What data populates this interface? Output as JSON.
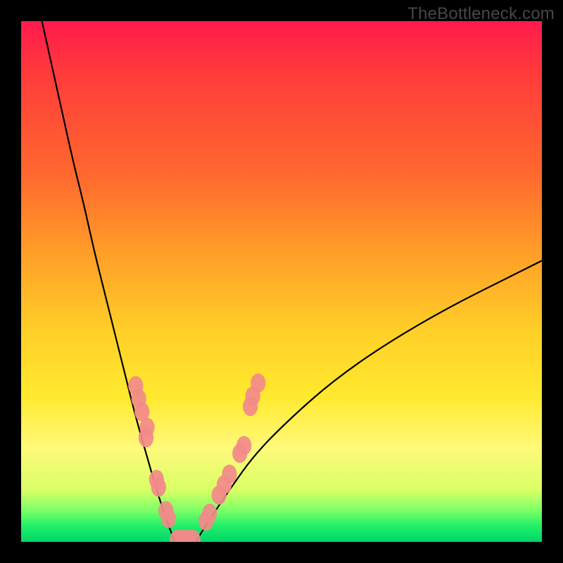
{
  "watermark": "TheBottleneck.com",
  "chart_data": {
    "type": "line",
    "title": "",
    "xlabel": "",
    "ylabel": "",
    "xlim": [
      0,
      100
    ],
    "ylim": [
      0,
      100
    ],
    "gradient_bands": [
      {
        "label": "high-bottleneck",
        "color": "#ff1a4d",
        "y_top": 100,
        "y_bottom": 55
      },
      {
        "label": "mid-bottleneck",
        "color": "#ffd028",
        "y_top": 55,
        "y_bottom": 12
      },
      {
        "label": "low-bottleneck",
        "color": "#00d66a",
        "y_top": 12,
        "y_bottom": 0
      }
    ],
    "series": [
      {
        "name": "left-branch",
        "x": [
          4,
          6,
          8,
          10,
          12,
          14,
          16,
          18,
          20,
          22,
          24,
          26,
          28,
          29.5
        ],
        "y": [
          100,
          91,
          82,
          73,
          65,
          56,
          48,
          40,
          32,
          24,
          17,
          10,
          4,
          0
        ]
      },
      {
        "name": "right-branch",
        "x": [
          33.5,
          36,
          40,
          45,
          52,
          60,
          70,
          82,
          94,
          100
        ],
        "y": [
          0,
          4,
          10,
          17,
          24,
          31,
          38,
          45,
          51,
          54
        ]
      }
    ],
    "flat_bottom": {
      "x_start": 29.5,
      "x_end": 33.5,
      "y": 0
    },
    "markers": [
      {
        "x": 22.0,
        "y": 30.0,
        "r": 1.6
      },
      {
        "x": 22.6,
        "y": 27.5,
        "r": 1.6
      },
      {
        "x": 23.2,
        "y": 25.0,
        "r": 1.6
      },
      {
        "x": 24.2,
        "y": 22.0,
        "r": 1.6
      },
      {
        "x": 24.0,
        "y": 20.0,
        "r": 1.6
      },
      {
        "x": 26.0,
        "y": 12.0,
        "r": 1.6
      },
      {
        "x": 26.4,
        "y": 10.5,
        "r": 1.6
      },
      {
        "x": 27.8,
        "y": 6.0,
        "r": 1.6
      },
      {
        "x": 28.3,
        "y": 4.5,
        "r": 1.6
      },
      {
        "x": 30.0,
        "y": 0.5,
        "r": 1.6
      },
      {
        "x": 31.0,
        "y": 0.5,
        "r": 1.6
      },
      {
        "x": 32.0,
        "y": 0.5,
        "r": 1.6
      },
      {
        "x": 33.0,
        "y": 0.5,
        "r": 1.6
      },
      {
        "x": 35.5,
        "y": 4.0,
        "r": 1.6
      },
      {
        "x": 36.2,
        "y": 5.5,
        "r": 1.6
      },
      {
        "x": 38.0,
        "y": 9.0,
        "r": 1.6
      },
      {
        "x": 39.0,
        "y": 11.0,
        "r": 1.6
      },
      {
        "x": 40.0,
        "y": 13.0,
        "r": 1.6
      },
      {
        "x": 42.0,
        "y": 17.0,
        "r": 1.6
      },
      {
        "x": 42.8,
        "y": 18.5,
        "r": 1.6
      },
      {
        "x": 44.0,
        "y": 26.0,
        "r": 1.6
      },
      {
        "x": 44.5,
        "y": 28.0,
        "r": 1.6
      },
      {
        "x": 45.5,
        "y": 30.5,
        "r": 1.6
      }
    ]
  }
}
